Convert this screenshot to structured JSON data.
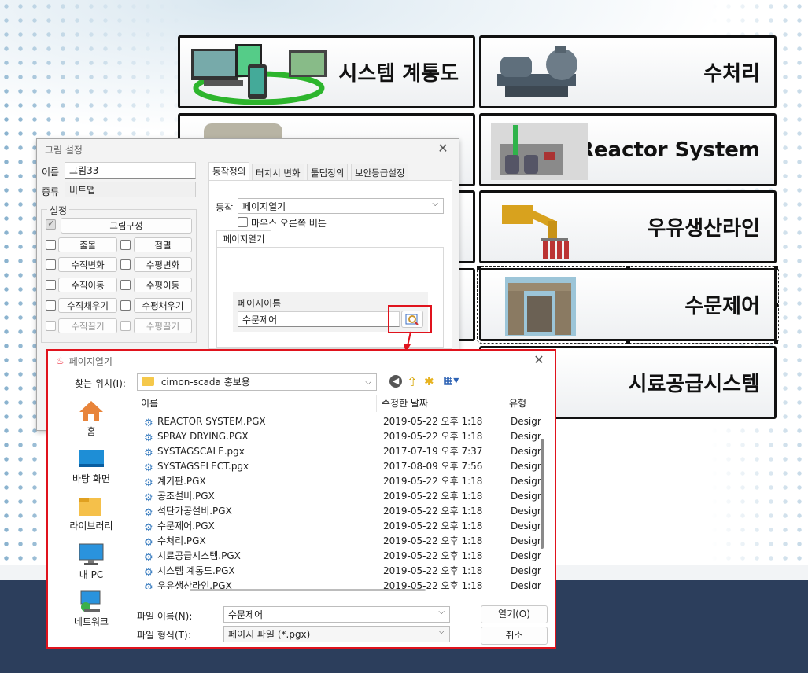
{
  "tiles": [
    {
      "label": "시스템 계통도"
    },
    {
      "label": "수처리"
    },
    {
      "label": "Reactor System"
    },
    {
      "label": "우유생산라인"
    },
    {
      "label": "수문제어"
    },
    {
      "label": "시료공급시스템"
    }
  ],
  "props_dialog": {
    "title": "그림 설정",
    "name_label": "이름",
    "name_value": "그림33",
    "kind_label": "종류",
    "kind_value": "비트맵",
    "settings_label": "설정",
    "compose_button": "그림구성",
    "options": [
      {
        "left": "출몰",
        "right": "점멸"
      },
      {
        "left": "수직변화",
        "right": "수평변화"
      },
      {
        "left": "수직이동",
        "right": "수평이동"
      },
      {
        "left": "수직채우기",
        "right": "수평채우기"
      },
      {
        "left": "수직끌기",
        "right": "수평끌기"
      }
    ],
    "tabs": [
      "동작정의",
      "터치시 변화",
      "툴팁정의",
      "보안등급설정"
    ],
    "action_label": "동작",
    "action_value": "페이지열기",
    "right_click_label": "마우스 오른쪽 버튼",
    "subtab": "페이지열기",
    "page_name_label": "페이지이름",
    "page_name_value": "수문제어"
  },
  "file_dialog": {
    "title": "페이지열기",
    "look_in_label": "찾는 위치(I):",
    "look_in_value": "cimon-scada 홍보용",
    "columns": {
      "name": "이름",
      "date": "수정한 날짜",
      "type": "유형"
    },
    "nav": [
      "홈",
      "바탕 화면",
      "라이브러리",
      "내 PC",
      "네트워크"
    ],
    "files": [
      {
        "name": "REACTOR SYSTEM.PGX",
        "date": "2019-05-22 오후 1:18",
        "type": "Desigr"
      },
      {
        "name": "SPRAY DRYING.PGX",
        "date": "2019-05-22 오후 1:18",
        "type": "Desigr"
      },
      {
        "name": "SYSTAGSCALE.pgx",
        "date": "2017-07-19 오후 7:37",
        "type": "Desigr"
      },
      {
        "name": "SYSTAGSELECT.pgx",
        "date": "2017-08-09 오후 7:56",
        "type": "Desigr"
      },
      {
        "name": "계기판.PGX",
        "date": "2019-05-22 오후 1:18",
        "type": "Desigr"
      },
      {
        "name": "공조설비.PGX",
        "date": "2019-05-22 오후 1:18",
        "type": "Desigr"
      },
      {
        "name": "석탄가공설비.PGX",
        "date": "2019-05-22 오후 1:18",
        "type": "Desigr"
      },
      {
        "name": "수문제어.PGX",
        "date": "2019-05-22 오후 1:18",
        "type": "Desigr"
      },
      {
        "name": "수처리.PGX",
        "date": "2019-05-22 오후 1:18",
        "type": "Desigr"
      },
      {
        "name": "시료공급시스템.PGX",
        "date": "2019-05-22 오후 1:18",
        "type": "Desigr"
      },
      {
        "name": "시스템 계통도.PGX",
        "date": "2019-05-22 오후 1:18",
        "type": "Desigr"
      },
      {
        "name": "우유생산라인.PGX",
        "date": "2019-05-22 오후 1:18",
        "type": "Desigr"
      }
    ],
    "filename_label": "파일 이름(N):",
    "filename_value": "수문제어",
    "filetype_label": "파일 형식(T):",
    "filetype_value": "페이지 파일 (*.pgx)",
    "open_button": "열기(O)",
    "cancel_button": "취소"
  },
  "colors": {
    "highlight": "#e0131d",
    "band": "#2c3e5c"
  }
}
